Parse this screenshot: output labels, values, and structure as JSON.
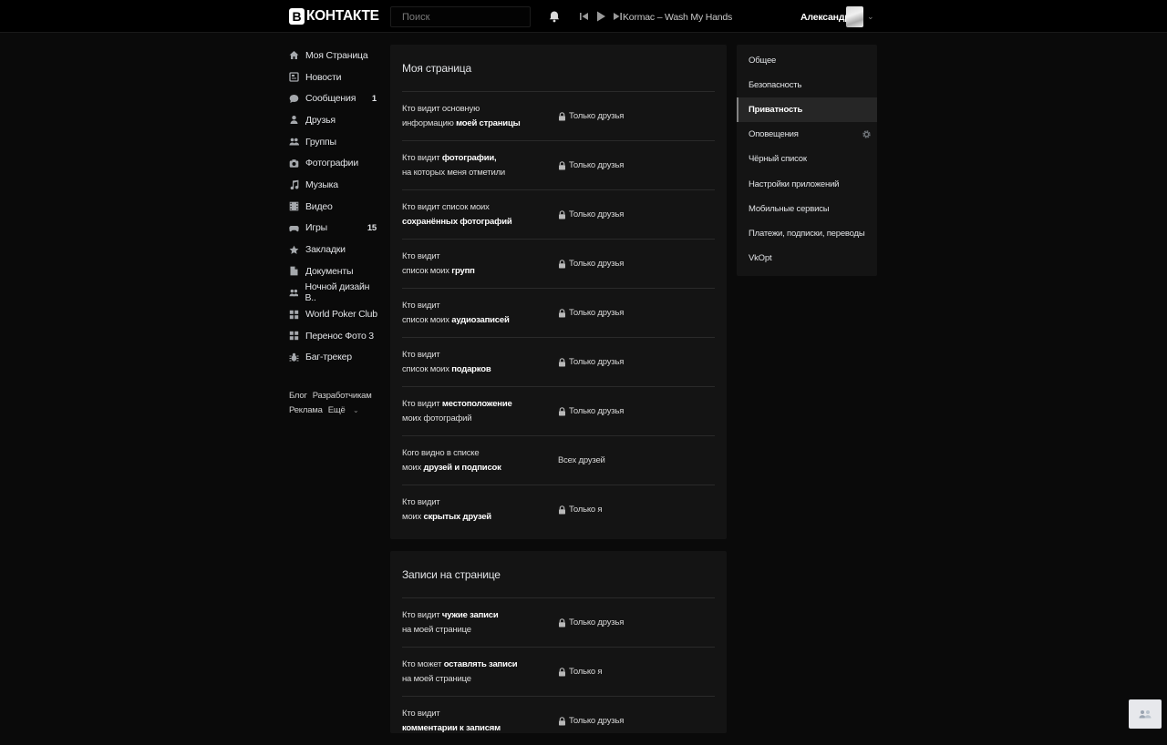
{
  "header": {
    "logo_letter": "В",
    "logo_text": "КОНТАКТЕ",
    "search_placeholder": "Поиск",
    "track": "Kormac – Wash My Hands",
    "user_name": "Александр"
  },
  "leftnav": {
    "items": [
      {
        "label": "Моя Страница",
        "icon": "home-icon"
      },
      {
        "label": "Новости",
        "icon": "news-icon"
      },
      {
        "label": "Сообщения",
        "icon": "messages-icon",
        "count": "1"
      },
      {
        "label": "Друзья",
        "icon": "friends-icon"
      },
      {
        "label": "Группы",
        "icon": "groups-icon"
      },
      {
        "label": "Фотографии",
        "icon": "camera-icon"
      },
      {
        "label": "Музыка",
        "icon": "music-icon"
      },
      {
        "label": "Видео",
        "icon": "video-icon"
      },
      {
        "label": "Игры",
        "icon": "games-icon",
        "count": "15"
      },
      {
        "label": "Закладки",
        "icon": "star-icon"
      },
      {
        "label": "Документы",
        "icon": "document-icon"
      },
      {
        "label": "Ночной дизайн В..",
        "icon": "app-icon"
      },
      {
        "label": "World Poker Club",
        "icon": "app-grid-icon"
      },
      {
        "label": "Перенос Фото 3",
        "icon": "app-grid-icon"
      },
      {
        "label": "Баг-трекер",
        "icon": "bug-icon"
      }
    ],
    "footer": {
      "blog": "Блог",
      "dev": "Разработчикам",
      "ads": "Реклама",
      "more": "Ещё"
    }
  },
  "privacy": {
    "section1": {
      "title": "Моя страница",
      "rows": [
        {
          "pre": "Кто видит основную",
          "line2_pre": "информацию ",
          "bold": "моей страницы",
          "value": "Только друзья",
          "lock": true,
          "mode": "a"
        },
        {
          "pre": "Кто видит ",
          "bold1": "фотографии,",
          "line2": "на которых меня отметили",
          "value": "Только друзья",
          "lock": true,
          "mode": "b"
        },
        {
          "pre": "Кто видит список моих",
          "line2_bold": "сохранённых фотографий",
          "value": "Только друзья",
          "lock": true,
          "mode": "c"
        },
        {
          "pre": "Кто видит",
          "line2_pre": "список моих ",
          "bold": "групп",
          "value": "Только друзья",
          "lock": true,
          "mode": "a"
        },
        {
          "pre": "Кто видит",
          "line2_pre": "список моих ",
          "bold": "аудиозаписей",
          "value": "Только друзья",
          "lock": true,
          "mode": "a"
        },
        {
          "pre": "Кто видит",
          "line2_pre": "список моих ",
          "bold": "подарков",
          "value": "Только друзья",
          "lock": true,
          "mode": "a"
        },
        {
          "pre": "Кто видит ",
          "bold1": "местоположение",
          "line2": "моих фотографий",
          "value": "Только друзья",
          "lock": true,
          "mode": "b"
        },
        {
          "pre": "Кого видно в списке",
          "line2_pre": "моих ",
          "bold": "друзей и подписок",
          "value": "Всех друзей",
          "lock": false,
          "mode": "a"
        },
        {
          "pre": "Кто видит",
          "line2_pre": "моих ",
          "bold": "скрытых друзей",
          "value": "Только я",
          "lock": true,
          "mode": "a"
        }
      ]
    },
    "section2": {
      "title": "Записи на странице",
      "rows": [
        {
          "pre": "Кто видит ",
          "bold1": "чужие записи",
          "line2": "на моей странице",
          "value": "Только друзья",
          "lock": true,
          "mode": "b"
        },
        {
          "pre": "Кто может ",
          "bold1": "оставлять записи",
          "line2": "на моей странице",
          "value": "Только я",
          "lock": true,
          "mode": "b"
        },
        {
          "pre": "Кто видит",
          "line2_bold": "комментарии к записям",
          "value": "Только друзья",
          "lock": true,
          "mode": "c"
        }
      ]
    }
  },
  "settings_menu": {
    "items": [
      {
        "label": "Общее"
      },
      {
        "label": "Безопасность"
      },
      {
        "label": "Приватность",
        "active": true
      },
      {
        "label": "Оповещения",
        "gear": true
      },
      {
        "label": "Чёрный список"
      },
      {
        "label": "Настройки приложений"
      },
      {
        "label": "Мобильные сервисы"
      },
      {
        "label": "Платежи, подписки, переводы"
      },
      {
        "label": "VkOpt"
      }
    ]
  }
}
